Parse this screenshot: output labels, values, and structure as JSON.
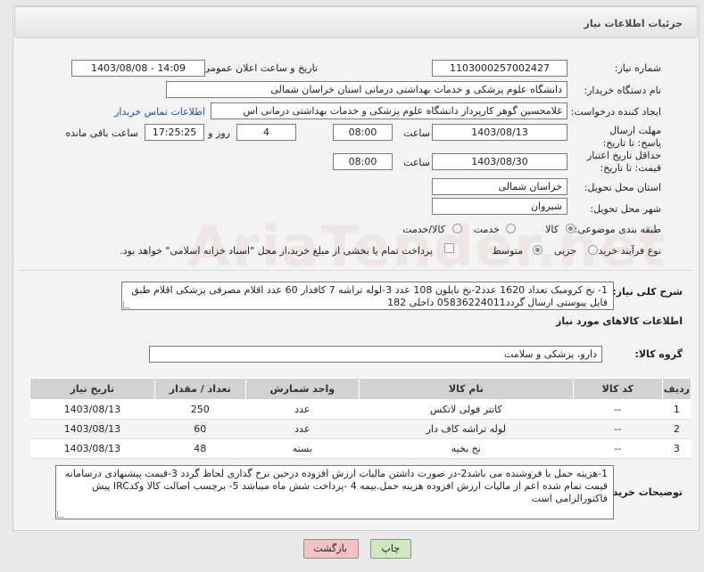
{
  "header": {
    "title": "جزئیات اطلاعات نیاز"
  },
  "fields": {
    "need_number": {
      "label": "شماره نیاز:",
      "value": "1103000257002427"
    },
    "announce_datetime": {
      "label": "تاریخ و ساعت اعلان عمومی:",
      "value": "1403/08/08 - 14:09"
    },
    "buyer_org": {
      "label": "نام دستگاه خریدار:",
      "value": "دانشگاه علوم پزشکی و خدمات بهداشتی درمانی استان خراسان شمالی"
    },
    "requester": {
      "label": "ایجاد کننده درخواست:",
      "value": "غلامحسین گوهر کارپرداز  دانشگاه علوم پزشکی و خدمات بهداشتی درمانی اس",
      "contact_link": "اطلاعات تماس خریدار"
    },
    "reply_deadline": {
      "label": "مهلت ارسال پاسخ: تا تاریخ:",
      "date": "1403/08/13",
      "time_label": "ساعت",
      "time": "08:00",
      "days": "4",
      "days_label": "روز و",
      "remaining": "17:25:25",
      "remaining_label": "ساعت باقی مانده"
    },
    "price_validity": {
      "label": "حداقل تاریخ اعتبار قیمت: تا تاریخ:",
      "date": "1403/08/30",
      "time_label": "ساعت",
      "time": "08:00"
    },
    "province": {
      "label": "استان محل تحویل:",
      "value": "خراسان شمالی"
    },
    "city": {
      "label": "شهر محل تحویل:",
      "value": "شیروان"
    },
    "category": {
      "label": "طبقه بندی موضوعی:",
      "options": [
        "کالا",
        "خدمت",
        "کالا/خدمت"
      ],
      "selected": "کالا"
    },
    "purchase_type": {
      "label": "نوع فرآیند خرید :",
      "options": [
        "جزیی",
        "متوسط"
      ],
      "selected": "متوسط",
      "payment_note": "پرداخت تمام یا بخشی از مبلغ خرید،از محل \"اسناد خزانه اسلامی\" خواهد بود."
    }
  },
  "summary": {
    "label": "شرح کلی نیاز:",
    "text": "1- نخ کرومیک تعداد 1620 عدد2-نخ نایلون 108 عدد 3-لوله تراشه 7 کافدار 60 عدد  اقلام مصرفی پزشکی اقلام طبق فایل پیوستی ارسال گردد05836224011 داخلی 182"
  },
  "goods_info": {
    "title": "اطلاعات کالاهای مورد نیاز",
    "group_label": "گروه کالا:",
    "group_value": "دارو، پزشکی و سلامت"
  },
  "table": {
    "headers": [
      "ردیف",
      "کد کالا",
      "نام کالا",
      "واحد شمارش",
      "تعداد / مقدار",
      "تاریخ نیاز"
    ],
    "rows": [
      [
        "1",
        "--",
        "کاتتر فولی لاتکس",
        "عدد",
        "250",
        "1403/08/13"
      ],
      [
        "2",
        "--",
        "لوله تراشه کاف دار",
        "عدد",
        "60",
        "1403/08/13"
      ],
      [
        "3",
        "--",
        "نخ بخیه",
        "بسته",
        "48",
        "1403/08/13"
      ]
    ]
  },
  "buyer_notes": {
    "label": "توضیحات خریدار:",
    "text": "1-هزینه حمل با فروشنده می باشد2-در صورت داشتن مالیات ارزش افزوده درحین نرخ گذاری لحاظ گردد 3-قیمت پیشنهادی درسامانه  قیمت تمام شده اعم از مالیات ارزش افزوده هزینه حمل.بیمه 4 -پرداخت شش ماه میباشد 5- برچسب اصالت کالا وکدIRC پیش فاکتورالزامی است"
  },
  "buttons": {
    "print": "چاپ",
    "back": "بازگشت"
  },
  "watermark": "AriaTender.net"
}
